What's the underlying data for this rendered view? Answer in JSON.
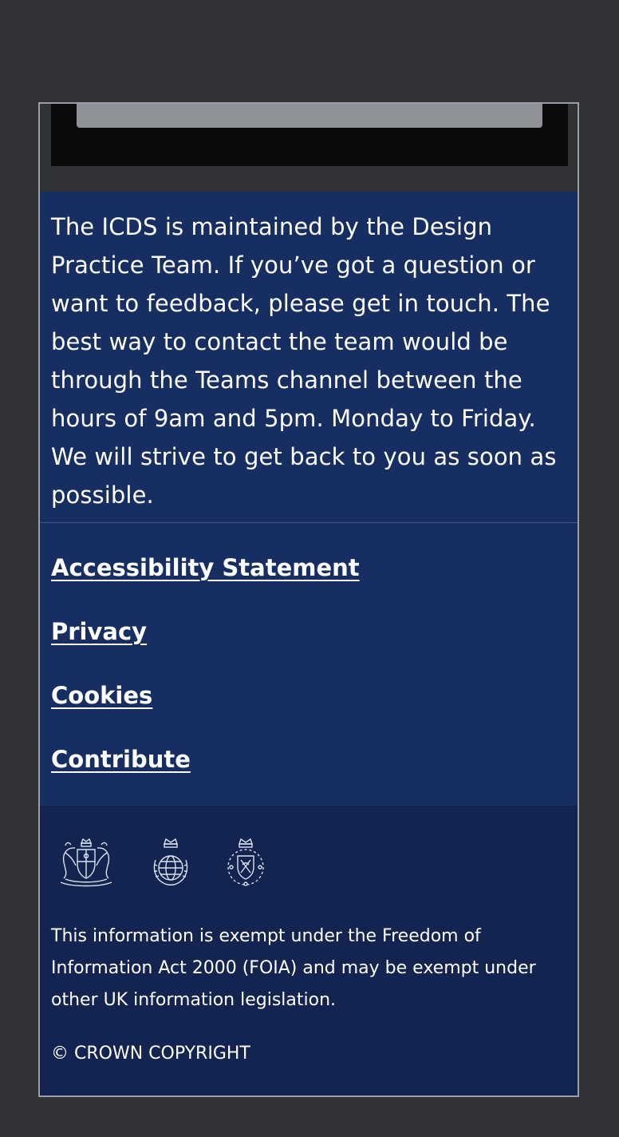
{
  "contact": {
    "text": "The ICDS is maintained by the Design Practice Team. If you’ve got a question or want to feedback, please get in touch. The best way to contact the team would be through the Teams channel between the hours of 9am and 5pm. Monday to Friday. We will strive to get back to you as soon as possible."
  },
  "footer_links": [
    {
      "label": "Accessibility Statement"
    },
    {
      "label": "Privacy"
    },
    {
      "label": "Cookies"
    },
    {
      "label": "Contribute"
    }
  ],
  "crests": [
    "royal-coat-of-arms-icon",
    "crown-globe-crest-icon",
    "crown-shield-crest-icon"
  ],
  "notice": "This information is exempt under the Freedom of Information Act 2000 (FOIA) and may be exempt under other UK information legislation.",
  "copyright": "© CROWN COPYRIGHT",
  "colors": {
    "page_background": "#303236",
    "panel_background": "#172e63",
    "footer_background": "#12244f",
    "text": "#ffffff"
  }
}
